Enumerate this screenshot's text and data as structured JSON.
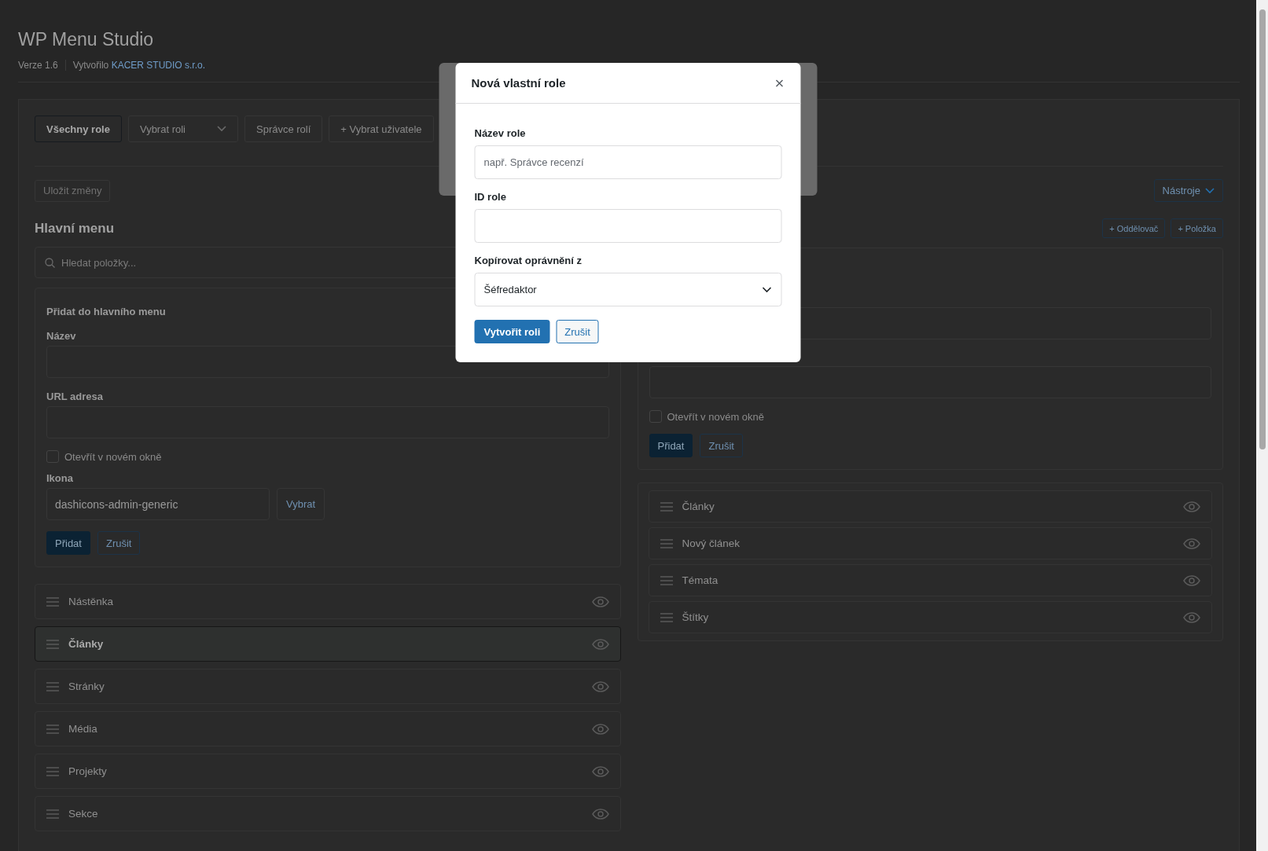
{
  "header": {
    "title": "WP Menu Studio",
    "version": "Verze 1.6",
    "credit_prefix": "Vytvořilo",
    "credit_link": "KACER STUDIO s.r.o."
  },
  "toolbar": [
    {
      "label": "Všechny role",
      "kind": "button",
      "selected": true
    },
    {
      "label": "Vybrat roli",
      "kind": "select",
      "selected": false
    },
    {
      "label": "Správce rolí",
      "kind": "button",
      "selected": false
    },
    {
      "label": "+ Vybrat uživatele",
      "kind": "button",
      "selected": false
    }
  ],
  "save_button": {
    "label": "Uložit změny",
    "disabled": true
  },
  "left": {
    "title": "Hlavní menu",
    "search": {
      "placeholder": "Hledat položky..."
    },
    "add_form": {
      "title": "Přidat do hlavního menu",
      "name_label": "Název",
      "url_label": "URL adresa",
      "new_window": {
        "label": "Otevřít v novém okně",
        "checked": false
      },
      "icon_label": "Ikona",
      "icon_value": "dashicons-admin-generic",
      "pick_button": "Vybrat",
      "add_button": "Přidat",
      "cancel_button": "Zrušit"
    },
    "items": [
      {
        "label": "Nástěnka",
        "selected": false
      },
      {
        "label": "Články",
        "selected": true
      },
      {
        "label": "Stránky",
        "selected": false
      },
      {
        "label": "Média",
        "selected": false
      },
      {
        "label": "Projekty",
        "selected": false
      },
      {
        "label": "Sekce",
        "selected": false
      }
    ]
  },
  "right": {
    "tools_button": "Nástroje",
    "add_separator": "+ Oddělovač",
    "add_item": "+ Položka",
    "form": {
      "new_window": {
        "label": "Otevřít v novém okně",
        "checked": false
      },
      "add_button": "Přidat",
      "cancel_button": "Zrušit"
    },
    "items": [
      {
        "label": "Články",
        "selected": false
      },
      {
        "label": "Nový článek",
        "selected": false
      },
      {
        "label": "Témata",
        "selected": false
      },
      {
        "label": "Štítky",
        "selected": false
      }
    ]
  },
  "dialog": {
    "title": "Nová vlastní role",
    "fields": [
      {
        "label": "Název role",
        "kind": "text",
        "placeholder": "např. Správce recenzí"
      },
      {
        "label": "ID role",
        "kind": "text"
      },
      {
        "label": "Kopírovat oprávnění z",
        "kind": "select",
        "value": "Šéfredaktor"
      }
    ],
    "submit": "Vytvořit roli",
    "cancel": "Zrušit"
  }
}
